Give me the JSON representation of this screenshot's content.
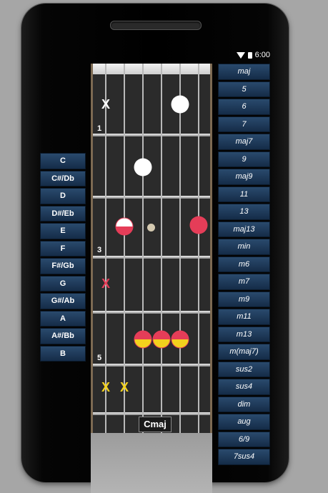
{
  "status": {
    "time": "6:00"
  },
  "chord": {
    "name": "Cmaj"
  },
  "fret_labels": [
    "1",
    "3",
    "5"
  ],
  "roots": [
    "C",
    "C#/Db",
    "D",
    "D#/Eb",
    "E",
    "F",
    "F#/Gb",
    "G",
    "G#/Ab",
    "A",
    "A#/Bb",
    "B"
  ],
  "types": [
    "maj",
    "5",
    "6",
    "7",
    "maj7",
    "9",
    "maj9",
    "11",
    "13",
    "maj13",
    "min",
    "m6",
    "m7",
    "m9",
    "m11",
    "m13",
    "m(maj7)",
    "sus2",
    "sus4",
    "dim",
    "aug",
    "6/9",
    "7sus4"
  ],
  "marks": {
    "x": "X"
  },
  "colors": {
    "root": "#e53d58",
    "third": "#f3d21d",
    "fifth": "#ffffff",
    "button": "#1e3a5a"
  }
}
